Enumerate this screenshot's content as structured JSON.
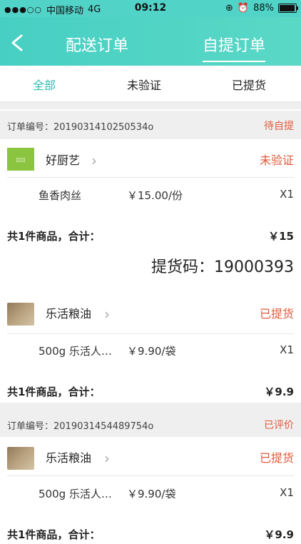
{
  "status_bar": {
    "carrier": "中国移动",
    "network": "4G",
    "time": "09:12",
    "battery": "88%",
    "battery_level": 0.88
  },
  "header": {
    "tab_delivery": "配送订单",
    "tab_pickup": "自提订单"
  },
  "filter_tabs": {
    "all": "全部",
    "unverified": "未验证",
    "picked_up": "已提货"
  },
  "orders": [
    {
      "order_no_label": "订单编号：",
      "order_no": "2019031410250534o",
      "status": "待自提",
      "store_name": "好厨艺",
      "store_status": "未验证",
      "item_name": "鱼香肉丝",
      "item_price": "￥15.00/份",
      "item_qty": "X1",
      "total_label": "共1件商品，合计：",
      "total_amount": "￥15",
      "pickup_code_label": "提货码：",
      "pickup_code": "19000393"
    },
    {
      "store_name": "乐活粮油",
      "store_status": "已提货",
      "item_name": "500g 乐活人…",
      "item_price": "￥9.90/袋",
      "item_qty": "X1",
      "total_label": "共1件商品，合计：",
      "total_amount": "￥9.9"
    },
    {
      "order_no_label": "订单编号：",
      "order_no": "2019031454489754o",
      "status": "已评价",
      "store_name": "乐活粮油",
      "store_status": "已提货",
      "item_name": "500g 乐活人…",
      "item_price": "￥9.90/袋",
      "item_qty": "X1",
      "total_label": "共1件商品，合计：",
      "total_amount": "￥9.9"
    }
  ],
  "colors": {
    "accent": "#2bbfb3",
    "header": "#52d3c8",
    "status_red": "#e05a3b"
  }
}
